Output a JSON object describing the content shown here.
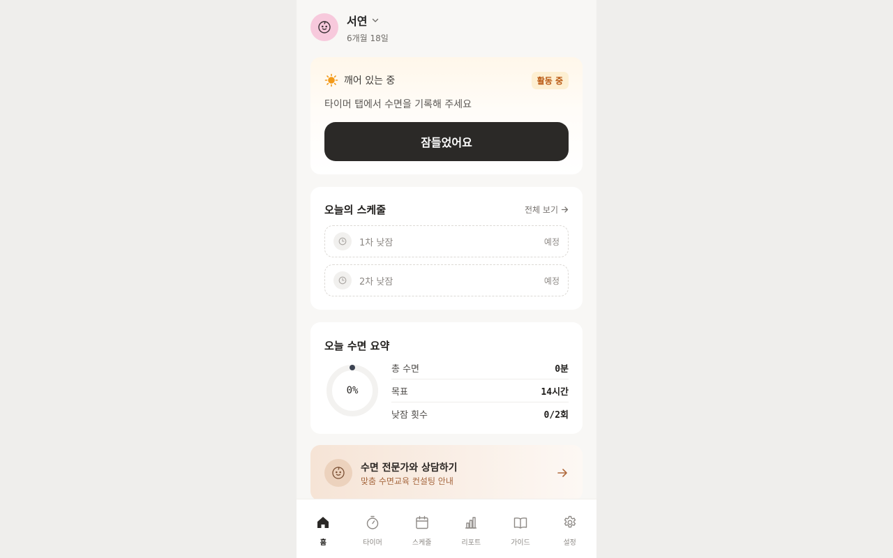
{
  "profile": {
    "name": "서연",
    "age": "6개월 18일"
  },
  "status_card": {
    "status": "깨어 있는 중",
    "badge": "활동 중",
    "hint": "타이머 탭에서 수면을 기록해 주세요",
    "button": "잠들었어요"
  },
  "schedule": {
    "title": "오늘의 스케줄",
    "see_all": "전체 보기",
    "items": [
      {
        "label": "1차 낮잠",
        "status": "예정"
      },
      {
        "label": "2차 낮잠",
        "status": "예정"
      }
    ]
  },
  "summary": {
    "title": "오늘 수면 요약",
    "progress_label": "0%",
    "progress": 0,
    "stats": [
      {
        "label": "총 수면",
        "value": "0분"
      },
      {
        "label": "목표",
        "value": "14시간"
      },
      {
        "label": "낮잠 횟수",
        "value": "0/2회"
      }
    ]
  },
  "promo": {
    "title": "수면 전문가와 상담하기",
    "subtitle": "맞춤 수면교육 컨설팅 안내"
  },
  "nav": {
    "items": [
      {
        "label": "홈",
        "icon": "home-icon",
        "active": true
      },
      {
        "label": "타이머",
        "icon": "timer-icon",
        "active": false
      },
      {
        "label": "스케줄",
        "icon": "calendar-icon",
        "active": false
      },
      {
        "label": "리포트",
        "icon": "chart-icon",
        "active": false
      },
      {
        "label": "가이드",
        "icon": "book-icon",
        "active": false
      },
      {
        "label": "설정",
        "icon": "gear-icon",
        "active": false
      }
    ]
  },
  "colors": {
    "background": "#efeeec",
    "avatar": "#f7c9dc",
    "primary_button": "#2b2927",
    "badge_bg": "#fdefd2",
    "badge_text": "#b8560f",
    "sun": "#f29a1a",
    "promo_accent": "#a5663d"
  }
}
